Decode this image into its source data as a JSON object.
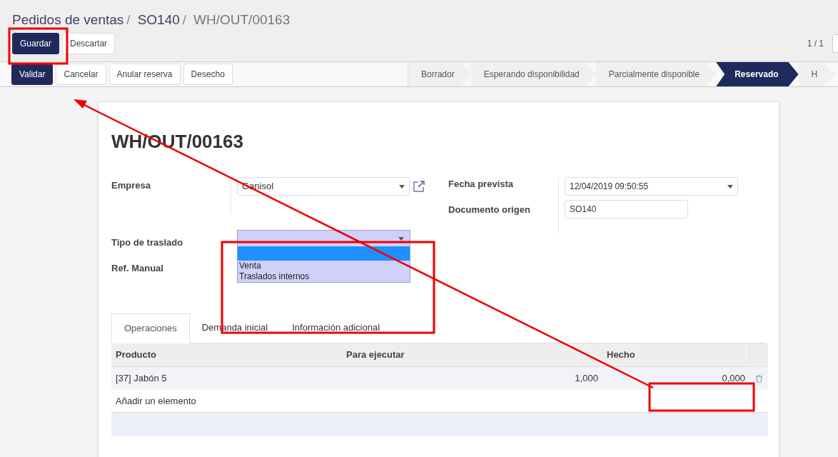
{
  "breadcrumb": [
    {
      "label": "Pedidos de ventas",
      "separator": "/",
      "kind": "link"
    },
    {
      "label": "SO140",
      "separator": "/",
      "kind": "link"
    },
    {
      "label": "WH/OUT/00163",
      "kind": "current"
    }
  ],
  "form_buttons": [
    {
      "label": "Guardar",
      "kind": "primary"
    },
    {
      "label": "Descartar",
      "kind": "secondary"
    }
  ],
  "pager": "1 / 1",
  "action_buttons": [
    {
      "label": "Validar",
      "kind": "primary"
    },
    {
      "label": "Cancelar",
      "kind": "secondary"
    },
    {
      "label": "Anular reserva",
      "kind": "secondary"
    },
    {
      "label": "Desecho",
      "kind": "secondary"
    }
  ],
  "stages": [
    {
      "label": "Borrador",
      "selected": false
    },
    {
      "label": "Esperando disponibilidad",
      "selected": false
    },
    {
      "label": "Parcialmente disponible",
      "selected": false
    },
    {
      "label": "Reservado",
      "selected": true
    },
    {
      "label": "H",
      "selected": false
    }
  ],
  "record_title": "WH/OUT/00163",
  "fields_left": [
    {
      "label": "Empresa",
      "value": "Ganisol",
      "kind": "many2one"
    }
  ],
  "fields_right": [
    {
      "label": "Fecha prevista",
      "value": "12/04/2019 09:50:55",
      "kind": "date"
    },
    {
      "label": "Documento origen",
      "value": "SO140",
      "kind": "text"
    }
  ],
  "fields_lower": [
    {
      "label": "Tipo de traslado"
    },
    {
      "label": "Ref. Manual"
    }
  ],
  "open_dropdown": {
    "blank_option_highlighted": true,
    "options": [
      {
        "label": "Venta",
        "selected": false
      },
      {
        "label": "Traslados internos",
        "selected": false
      }
    ]
  },
  "tabs": [
    {
      "label": "Operaciones",
      "selected": true
    },
    {
      "label": "Demanda inicial",
      "selected": false
    },
    {
      "label": "Información adicional",
      "selected": false
    }
  ],
  "table": {
    "columns": [
      "Producto",
      "Para ejecutar",
      "Hecho"
    ],
    "rows": [
      {
        "cells": [
          "[37] Jabón 5",
          "1,000",
          "0,000"
        ]
      }
    ],
    "add_line": "Añadir un elemento"
  }
}
